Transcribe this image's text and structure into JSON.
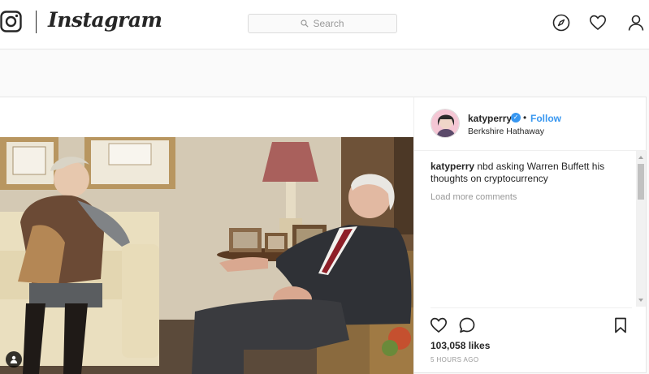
{
  "header": {
    "wordmark": "Instagram",
    "search_placeholder": "Search"
  },
  "icons": {
    "logo": "camera-logo-icon",
    "explore": "compass-icon",
    "activity": "heart-icon",
    "profile": "person-icon",
    "like": "heart-icon",
    "comment": "comment-icon",
    "save": "bookmark-icon",
    "tagged": "person-tag-icon"
  },
  "post": {
    "username": "katyperry",
    "verified_mark": "✓",
    "separator": "•",
    "follow_label": "Follow",
    "location": "Berkshire Hathaway",
    "caption_user": "katyperry",
    "caption_text": " nbd asking Warren Buffett his thoughts on cryptocurrency",
    "load_more": "Load more comments",
    "likes": "103,058 likes",
    "time": "5 HOURS AGO"
  },
  "colors": {
    "accent": "#3897f0",
    "text": "#262626",
    "muted": "#999999"
  }
}
